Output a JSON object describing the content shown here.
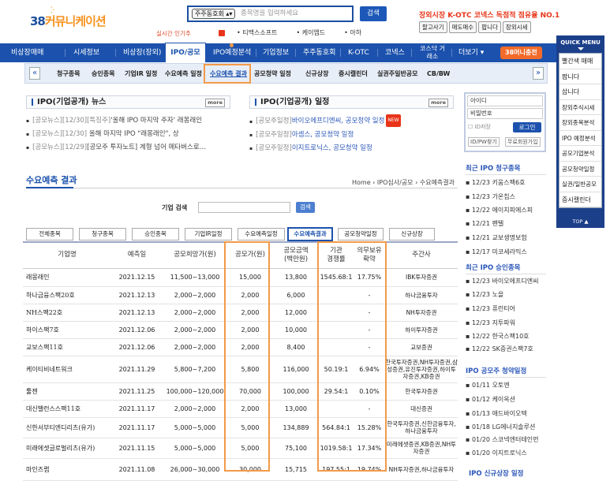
{
  "logo": {
    "num": "38",
    "name": "커뮤니케이션"
  },
  "search": {
    "select": "주주동호회",
    "placeholder": "종목명을 입력하세요",
    "button": "검색"
  },
  "promo": {
    "text": "장외시장 K-OTC 코넥스 독점적 점유율 NO.1",
    "buttons": [
      "팔고사기",
      "매도매수",
      "팝니다",
      "장외시세"
    ]
  },
  "popular": {
    "label": "실시간 인기주",
    "items": [
      "티맥스소프트",
      "케이엠드",
      "아하"
    ]
  },
  "mainnav": {
    "items": [
      "비상장매매",
      "시세정보",
      "비상장(장외)",
      "IPO/공모",
      "IPO예정분석",
      "기업정보",
      "주주동호회",
      "K-OTC",
      "코넥스",
      "코스닥 거래소",
      "더보기 ▾",
      "38머니충전"
    ]
  },
  "subnav": {
    "items": [
      "청구종목",
      "승인종목",
      "기업IR 일정",
      "수요예측 일정",
      "수요예측 결과",
      "공모청약 일정",
      "신규상장",
      "증시캘린더",
      "실권주일반공모",
      "CB/BW"
    ]
  },
  "news": {
    "title": "IPO(기업공개) 뉴스",
    "more": "more",
    "items": [
      {
        "tag": "[공모뉴스][12/30][특징주]",
        "text": "'올해 IPO 마지막 주자' 래몽래인"
      },
      {
        "tag": "[공모뉴스][12/30]",
        "text": "올해 마지막 IPO \"래몽래인\", 상"
      },
      {
        "tag": "[공모뉴스][12/29]",
        "text": "[공모주 투자노트] 계형 넘어 메타버스로…"
      }
    ]
  },
  "schedule": {
    "title": "IPO(기업공개) 일정",
    "more": "more",
    "items": [
      {
        "tag": "[공모주일정]",
        "text": "바이오에프디엔씨, 공모청약 일정",
        "badge": "NEW"
      },
      {
        "tag": "[공모주일정]",
        "text": "아셈스, 공모청약 일정",
        "badge": ""
      },
      {
        "tag": "[공모주일정]",
        "text": "이지트로닉스, 공모청약 일정",
        "badge": ""
      }
    ]
  },
  "login": {
    "id_label": "아이디",
    "pw_label": "비밀번호",
    "save_id": "ID저장",
    "login_btn": "로그인",
    "find": "ID/PW찾기",
    "join": "무료회원가입"
  },
  "page": {
    "title": "수요예측 결과",
    "breadcrumb": [
      "Home",
      "IPO심사/공모",
      "수요예측결과"
    ]
  },
  "company_search": {
    "label": "기업 검색",
    "button": "검색"
  },
  "tabs": [
    "전체종목",
    "청구종목",
    "승인종목",
    "기업IR일정",
    "수요예측일정",
    "수요예측결과",
    "공모청약일정",
    "신규상장"
  ],
  "table": {
    "headers": [
      "기업명",
      "예측일",
      "공모희망가(원)",
      "공모가(원)",
      "공모금액\n(백만원)",
      "기관\n경쟁률",
      "의무보유\n확약",
      "주간사"
    ],
    "rows": [
      [
        "래몽래인",
        "2021.12.15",
        "11,500~13,000",
        "15,000",
        "13,800",
        "1545.68:1",
        "17.75%",
        "IBK투자증권"
      ],
      [
        "하나금융스팩20호",
        "2021.12.13",
        "2,000~2,000",
        "2,000",
        "6,000",
        "",
        "-",
        "하나금융투자"
      ],
      [
        "NH스팩22호",
        "2021.12.13",
        "2,000~2,000",
        "2,000",
        "12,000",
        "",
        "-",
        "NH투자증권"
      ],
      [
        "하이스팩7호",
        "2021.12.06",
        "2,000~2,000",
        "2,000",
        "10,000",
        "",
        "-",
        "하이투자증권"
      ],
      [
        "교보스팩11호",
        "2021.12.06",
        "2,000~2,000",
        "2,000",
        "8,400",
        "",
        "-",
        "교보증권"
      ],
      [
        "케이티비네트워크",
        "2021.11.29",
        "5,800~7,200",
        "5,800",
        "116,000",
        "50.19:1",
        "6.94%",
        "한국투자증권,NH투자증권,삼성증권,유진투자증권,하이투자증권,KB증권"
      ],
      [
        "툴젠",
        "2021.11.25",
        "100,000~120,000",
        "70,000",
        "100,000",
        "29.54:1",
        "0.10%",
        "한국투자증권"
      ],
      [
        "대신밸런스스팩11호",
        "2021.11.17",
        "2,000~2,000",
        "2,000",
        "13,000",
        "",
        "-",
        "대신증권"
      ],
      [
        "신한서부티엔디리츠(유가)",
        "2021.11.17",
        "5,000~5,000",
        "5,000",
        "134,889",
        "564.84:1",
        "15.28%",
        "한국투자증권,신한금융투자,하나금융투자"
      ],
      [
        "미래에셋글로벌리츠(유가)",
        "2021.11.15",
        "5,000~5,000",
        "5,000",
        "75,100",
        "1019.58:1",
        "17.34%",
        "미래에셋증권,KB증권,NH투자증권"
      ],
      [
        "마인즈랩",
        "2021.11.08",
        "26,000~30,000",
        "30,000",
        "15,715",
        "197.55:1",
        "19.74%",
        "NH투자증권,하나금융투자"
      ]
    ]
  },
  "right": {
    "claim": {
      "title": "최근 IPO 청구종목",
      "items": [
        "12/23 키움스팩6호",
        "12/23 가온칩스",
        "12/22 에이치피에스피",
        "12/21 펜텔",
        "12/21 교보생명보험",
        "12/17 미코세라믹스"
      ]
    },
    "approve": {
      "title": "최근 IPO 승인종목",
      "items": [
        "12/23 바이오에프디엔씨",
        "12/23 노을",
        "12/23 퓨런티어",
        "12/23 지투파워",
        "12/22 한국스팩10호",
        "12/22 SK증권스팩7호"
      ]
    },
    "subscribe": {
      "title": "IPO 공모주 청약일정",
      "items": [
        "01/11 오토엔",
        "01/12 케이옥션",
        "01/13 애드바이오텍",
        "01/18 LG에너지솔루션",
        "01/20 스코넥엔터테인먼",
        "01/20 이지트로닉스"
      ]
    },
    "listing_title": "IPO 신규상장 일정"
  },
  "quick": {
    "title": "QUICK MENU",
    "items": [
      "빨간색 매매",
      "팝니다",
      "삽니다",
      "장외주식시세",
      "장외종목분석",
      "IPO 예정분석",
      "공모기업분석",
      "공모청약일정",
      "실권/일반공모",
      "증시캘린더"
    ],
    "top": "TOP ▲"
  }
}
